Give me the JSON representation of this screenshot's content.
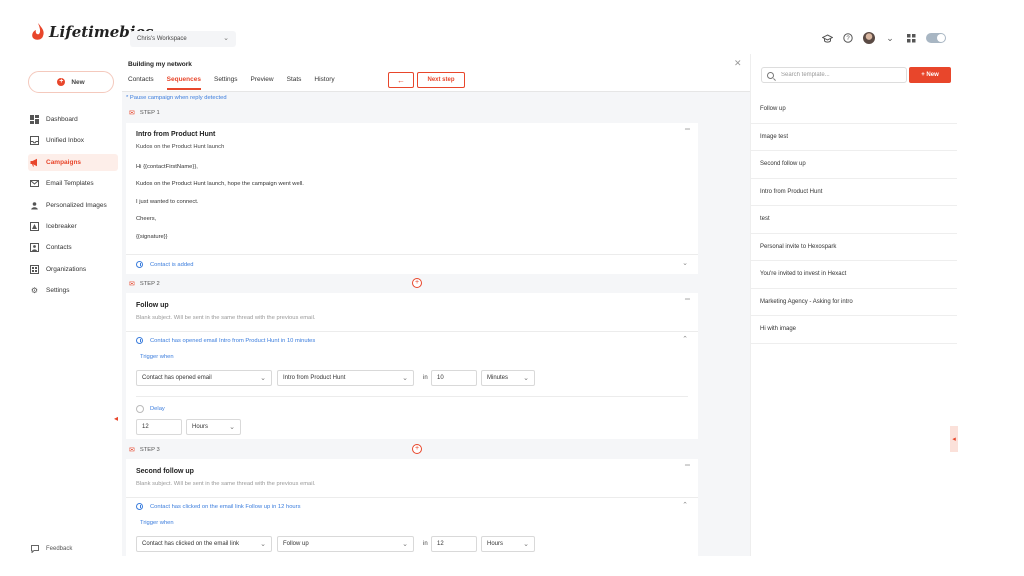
{
  "app": {
    "logo_text": "Lifetimebies",
    "workspace": "Chris's Workspace",
    "brand_color": "#e8462b"
  },
  "topbar": {
    "icons": [
      "graduation-cap-icon",
      "help-icon",
      "avatar",
      "chevron-down-icon",
      "grid-icon",
      "toggle"
    ]
  },
  "sidebar": {
    "new_label": "New",
    "items": [
      {
        "label": "Dashboard",
        "icon": "dashboard-icon",
        "active": false
      },
      {
        "label": "Unified Inbox",
        "icon": "inbox-icon",
        "active": false
      },
      {
        "label": "Campaigns",
        "icon": "megaphone-icon",
        "active": true
      },
      {
        "label": "Email Templates",
        "icon": "email-icon",
        "active": false
      },
      {
        "label": "Personalized Images",
        "icon": "image-person-icon",
        "active": false
      },
      {
        "label": "Icebreaker",
        "icon": "icebreaker-icon",
        "active": false
      },
      {
        "label": "Contacts",
        "icon": "contacts-icon",
        "active": false
      },
      {
        "label": "Organizations",
        "icon": "organization-icon",
        "active": false
      },
      {
        "label": "Settings",
        "icon": "gear-icon",
        "active": false
      }
    ],
    "feedback_label": "Feedback"
  },
  "main": {
    "campaign_title": "Building my network",
    "tabs": [
      {
        "label": "Contacts",
        "active": false
      },
      {
        "label": "Sequences",
        "active": true
      },
      {
        "label": "Settings",
        "active": false
      },
      {
        "label": "Preview",
        "active": false
      },
      {
        "label": "Stats",
        "active": false
      },
      {
        "label": "History",
        "active": false
      }
    ],
    "back_label": "←",
    "next_label": "Next step",
    "pause_link": "* Pause campaign when reply detected",
    "steps": [
      {
        "label": "STEP 1",
        "title": "Intro from Product Hunt",
        "subject": "Kudos on the Product Hunt launch",
        "body": [
          "Hi {{contactFirstName}},",
          "Kudos on the Product Hunt launch, hope the campaign went well.",
          "I just wanted to connect.",
          "Cheers,",
          "{{signature}}"
        ],
        "condition": "Contact is added"
      },
      {
        "label": "STEP 2",
        "title": "Follow up",
        "subject": "Blank subject. Will be sent in the same thread with the previous email.",
        "condition": "Contact has opened email Intro from Product Hunt in 10 minutes",
        "trigger_label": "Trigger when",
        "trigger_event": "Contact has opened email",
        "trigger_email": "Intro from Product Hunt",
        "in_label": "in",
        "trigger_amount": "10",
        "trigger_unit": "Minutes",
        "delay_label": "Delay",
        "delay_amount": "12",
        "delay_unit": "Hours"
      },
      {
        "label": "STEP 3",
        "title": "Second follow up",
        "subject": "Blank subject. Will be sent in the same thread with the previous email.",
        "condition": "Contact has clicked on the email link Follow up in 12 hours",
        "trigger_label": "Trigger when",
        "trigger_event": "Contact has clicked on the email link",
        "trigger_email": "Follow up",
        "in_label": "in",
        "trigger_amount": "12",
        "trigger_unit": "Hours"
      }
    ]
  },
  "templates": {
    "search_placeholder": "Search template...",
    "new_label": "+ New",
    "items": [
      "Follow up",
      "Image test",
      "Second follow up",
      "Intro from Product Hunt",
      "test",
      "Personal invite to Hexospark",
      "You're invited to invest in Hexact",
      "Marketing Agency - Asking for intro",
      "Hi with image"
    ]
  }
}
